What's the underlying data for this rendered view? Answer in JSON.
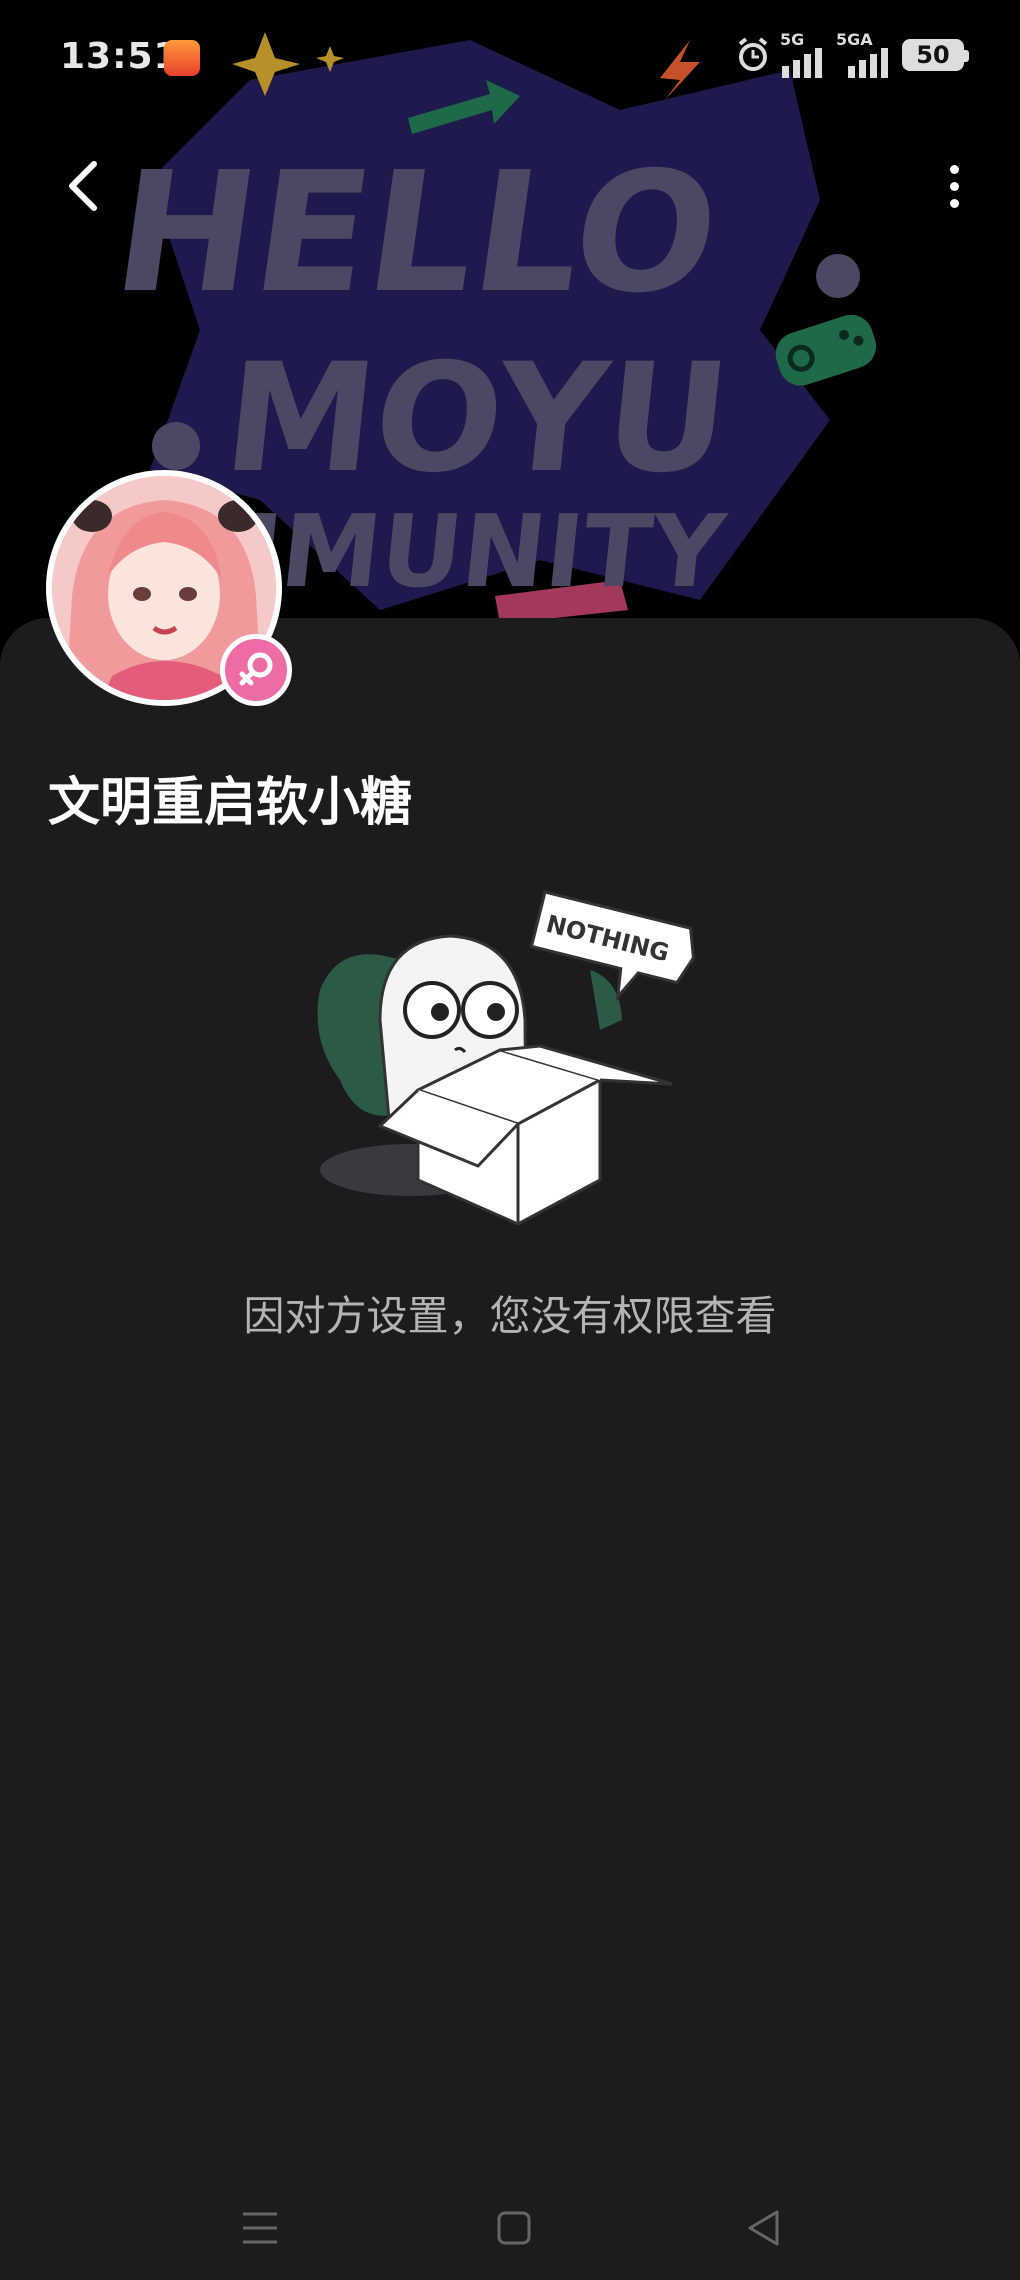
{
  "status_bar": {
    "time": "13:51",
    "net1": "5G",
    "net2": "5GA",
    "battery": "50",
    "icons": [
      "app-icon",
      "sparkle-icon",
      "charging-icon",
      "alarm-icon",
      "signal-icon",
      "signal-icon",
      "battery-icon"
    ]
  },
  "header": {
    "banner_text": [
      "HELLO",
      "MOYU",
      "MMUNITY"
    ],
    "back_icon": "chevron-left-icon",
    "more_icon": "more-vertical-icon"
  },
  "profile": {
    "username": "文明重启软小糖",
    "gender_icon": "female-icon"
  },
  "empty_state": {
    "sign_text": "NOTHING",
    "message": "因对方设置，您没有权限查看"
  },
  "nav_bar": {
    "items": [
      "menu-icon",
      "home-icon",
      "back-triangle-icon"
    ]
  },
  "colors": {
    "background": "#000000",
    "card": "#1c1c1e",
    "accent_pink": "#ee6ca6",
    "banner_text": "#4a4862",
    "banner_star": "#20194e",
    "controller_green": "#1e6a48"
  }
}
